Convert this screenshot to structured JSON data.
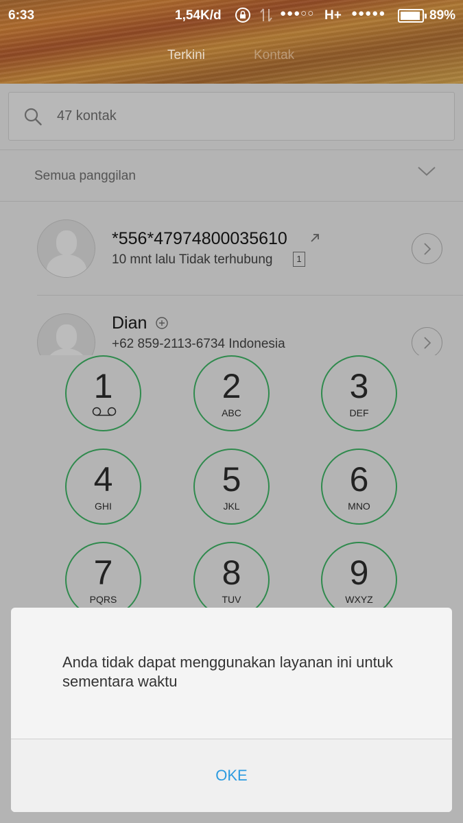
{
  "status_bar": {
    "time": "6:33",
    "speed": "1,54K/d",
    "signal1": "●●●○○",
    "network": "H+",
    "signal2": "●●●●●",
    "battery": "89%",
    "battery_level": 0.89
  },
  "tabs": [
    {
      "label": "Terkini"
    },
    {
      "label": "Kontak"
    }
  ],
  "search": {
    "placeholder": "47 kontak"
  },
  "filter": {
    "label": "Semua panggilan"
  },
  "calls": [
    {
      "name": "*556*47974800035610",
      "detail": "10 mnt lalu Tidak terhubung",
      "sim": "1"
    },
    {
      "name": "Dian",
      "detail": "+62 859-2113-6734  Indonesia"
    }
  ],
  "dialpad": [
    {
      "digit": "1",
      "letters": ""
    },
    {
      "digit": "2",
      "letters": "ABC"
    },
    {
      "digit": "3",
      "letters": "DEF"
    },
    {
      "digit": "4",
      "letters": "GHI"
    },
    {
      "digit": "5",
      "letters": "JKL"
    },
    {
      "digit": "6",
      "letters": "MNO"
    },
    {
      "digit": "7",
      "letters": "PQRS"
    },
    {
      "digit": "8",
      "letters": "TUV"
    },
    {
      "digit": "9",
      "letters": "WXYZ"
    }
  ],
  "dialog": {
    "message": "Anda tidak dapat menggunakan layanan ini untuk sementara waktu",
    "button_label": "OKE"
  },
  "colors": {
    "accent": "#2c9be0",
    "dial_ring": "#2f8a4d"
  }
}
